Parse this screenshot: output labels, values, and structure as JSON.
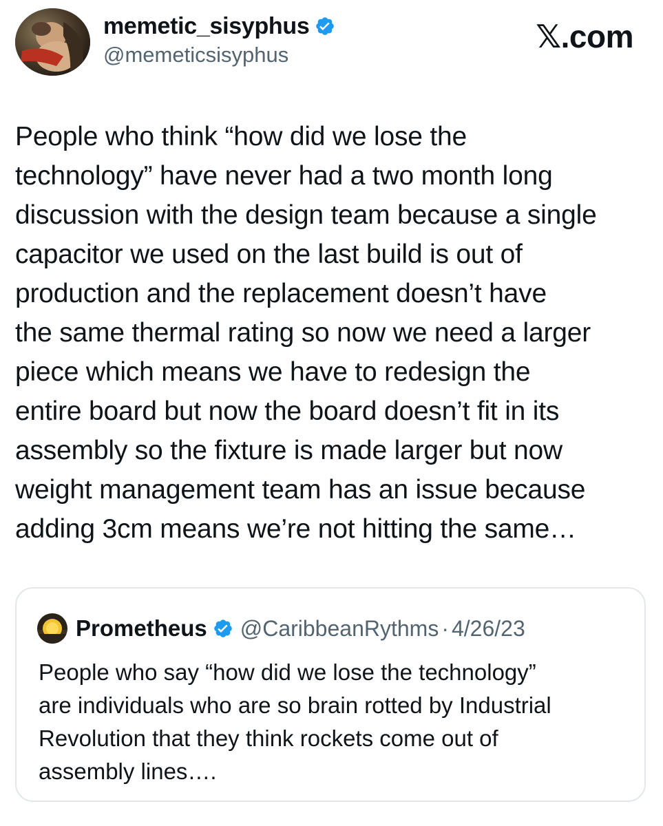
{
  "author": {
    "display_name": "memetic_sisyphus",
    "handle": "@memeticsisyphus",
    "verified": true,
    "avatar_icon": "painting-avatar"
  },
  "brand": {
    "logo_text": "𝕏.com"
  },
  "tweet": {
    "text": "People who think “how did we lose the\ntechnology” have never had a two month long\ndiscussion with the design team because a single\ncapacitor we used on the last build is out of\nproduction and the replacement doesn’t have\nthe same thermal rating so now we need a larger\npiece which means we have to redesign the\nentire board but now the board doesn’t fit in its\nassembly so the fixture is made larger but now\nweight management team has an issue because\nadding 3cm means we’re not hitting the same…"
  },
  "quoted_tweet": {
    "display_name": "Prometheus",
    "handle": "@CaribbeanRythms",
    "separator": "·",
    "date": "4/26/23",
    "verified": true,
    "avatar_icon": "sunset-avatar",
    "text": "People who say “how did we lose the technology”\nare individuals who are so brain rotted by Industrial\nRevolution that they think rockets come out of\nassembly lines…."
  },
  "colors": {
    "text_primary": "#0f1419",
    "text_secondary": "#536471",
    "verified_blue": "#1d9bf0",
    "card_border": "#e3e7ea"
  }
}
